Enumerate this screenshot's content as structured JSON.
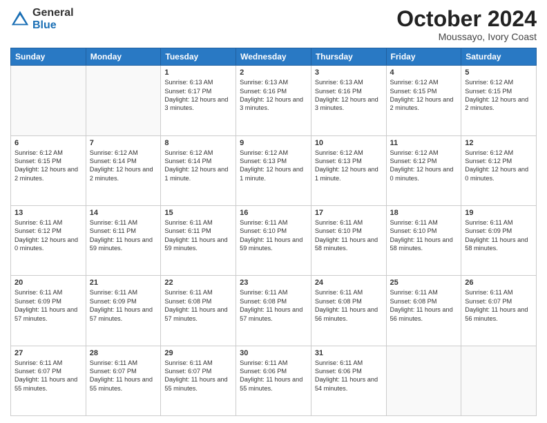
{
  "logo": {
    "general": "General",
    "blue": "Blue"
  },
  "header": {
    "month": "October 2024",
    "location": "Moussayo, Ivory Coast"
  },
  "days_of_week": [
    "Sunday",
    "Monday",
    "Tuesday",
    "Wednesday",
    "Thursday",
    "Friday",
    "Saturday"
  ],
  "weeks": [
    [
      {
        "day": "",
        "info": ""
      },
      {
        "day": "",
        "info": ""
      },
      {
        "day": "1",
        "info": "Sunrise: 6:13 AM\nSunset: 6:17 PM\nDaylight: 12 hours and 3 minutes."
      },
      {
        "day": "2",
        "info": "Sunrise: 6:13 AM\nSunset: 6:16 PM\nDaylight: 12 hours and 3 minutes."
      },
      {
        "day": "3",
        "info": "Sunrise: 6:13 AM\nSunset: 6:16 PM\nDaylight: 12 hours and 3 minutes."
      },
      {
        "day": "4",
        "info": "Sunrise: 6:12 AM\nSunset: 6:15 PM\nDaylight: 12 hours and 2 minutes."
      },
      {
        "day": "5",
        "info": "Sunrise: 6:12 AM\nSunset: 6:15 PM\nDaylight: 12 hours and 2 minutes."
      }
    ],
    [
      {
        "day": "6",
        "info": "Sunrise: 6:12 AM\nSunset: 6:15 PM\nDaylight: 12 hours and 2 minutes."
      },
      {
        "day": "7",
        "info": "Sunrise: 6:12 AM\nSunset: 6:14 PM\nDaylight: 12 hours and 2 minutes."
      },
      {
        "day": "8",
        "info": "Sunrise: 6:12 AM\nSunset: 6:14 PM\nDaylight: 12 hours and 1 minute."
      },
      {
        "day": "9",
        "info": "Sunrise: 6:12 AM\nSunset: 6:13 PM\nDaylight: 12 hours and 1 minute."
      },
      {
        "day": "10",
        "info": "Sunrise: 6:12 AM\nSunset: 6:13 PM\nDaylight: 12 hours and 1 minute."
      },
      {
        "day": "11",
        "info": "Sunrise: 6:12 AM\nSunset: 6:12 PM\nDaylight: 12 hours and 0 minutes."
      },
      {
        "day": "12",
        "info": "Sunrise: 6:12 AM\nSunset: 6:12 PM\nDaylight: 12 hours and 0 minutes."
      }
    ],
    [
      {
        "day": "13",
        "info": "Sunrise: 6:11 AM\nSunset: 6:12 PM\nDaylight: 12 hours and 0 minutes."
      },
      {
        "day": "14",
        "info": "Sunrise: 6:11 AM\nSunset: 6:11 PM\nDaylight: 11 hours and 59 minutes."
      },
      {
        "day": "15",
        "info": "Sunrise: 6:11 AM\nSunset: 6:11 PM\nDaylight: 11 hours and 59 minutes."
      },
      {
        "day": "16",
        "info": "Sunrise: 6:11 AM\nSunset: 6:10 PM\nDaylight: 11 hours and 59 minutes."
      },
      {
        "day": "17",
        "info": "Sunrise: 6:11 AM\nSunset: 6:10 PM\nDaylight: 11 hours and 58 minutes."
      },
      {
        "day": "18",
        "info": "Sunrise: 6:11 AM\nSunset: 6:10 PM\nDaylight: 11 hours and 58 minutes."
      },
      {
        "day": "19",
        "info": "Sunrise: 6:11 AM\nSunset: 6:09 PM\nDaylight: 11 hours and 58 minutes."
      }
    ],
    [
      {
        "day": "20",
        "info": "Sunrise: 6:11 AM\nSunset: 6:09 PM\nDaylight: 11 hours and 57 minutes."
      },
      {
        "day": "21",
        "info": "Sunrise: 6:11 AM\nSunset: 6:09 PM\nDaylight: 11 hours and 57 minutes."
      },
      {
        "day": "22",
        "info": "Sunrise: 6:11 AM\nSunset: 6:08 PM\nDaylight: 11 hours and 57 minutes."
      },
      {
        "day": "23",
        "info": "Sunrise: 6:11 AM\nSunset: 6:08 PM\nDaylight: 11 hours and 57 minutes."
      },
      {
        "day": "24",
        "info": "Sunrise: 6:11 AM\nSunset: 6:08 PM\nDaylight: 11 hours and 56 minutes."
      },
      {
        "day": "25",
        "info": "Sunrise: 6:11 AM\nSunset: 6:08 PM\nDaylight: 11 hours and 56 minutes."
      },
      {
        "day": "26",
        "info": "Sunrise: 6:11 AM\nSunset: 6:07 PM\nDaylight: 11 hours and 56 minutes."
      }
    ],
    [
      {
        "day": "27",
        "info": "Sunrise: 6:11 AM\nSunset: 6:07 PM\nDaylight: 11 hours and 55 minutes."
      },
      {
        "day": "28",
        "info": "Sunrise: 6:11 AM\nSunset: 6:07 PM\nDaylight: 11 hours and 55 minutes."
      },
      {
        "day": "29",
        "info": "Sunrise: 6:11 AM\nSunset: 6:07 PM\nDaylight: 11 hours and 55 minutes."
      },
      {
        "day": "30",
        "info": "Sunrise: 6:11 AM\nSunset: 6:06 PM\nDaylight: 11 hours and 55 minutes."
      },
      {
        "day": "31",
        "info": "Sunrise: 6:11 AM\nSunset: 6:06 PM\nDaylight: 11 hours and 54 minutes."
      },
      {
        "day": "",
        "info": ""
      },
      {
        "day": "",
        "info": ""
      }
    ]
  ]
}
